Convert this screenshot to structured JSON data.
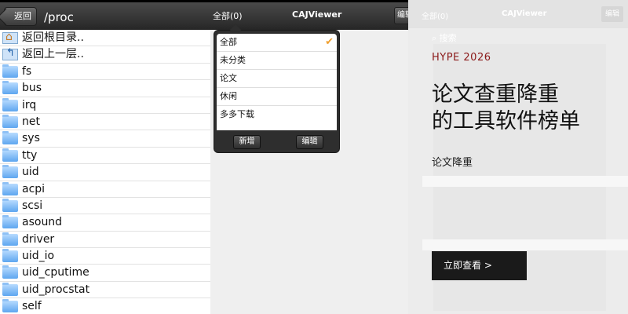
{
  "left": {
    "back_label": "返回",
    "path": "/proc",
    "items": [
      {
        "name": "返回根目录..",
        "icon": "home-icon"
      },
      {
        "name": "返回上一层..",
        "icon": "up-folder-icon"
      },
      {
        "name": "fs",
        "icon": "folder-icon"
      },
      {
        "name": "bus",
        "icon": "folder-icon"
      },
      {
        "name": "irq",
        "icon": "folder-icon"
      },
      {
        "name": "net",
        "icon": "folder-icon"
      },
      {
        "name": "sys",
        "icon": "folder-icon"
      },
      {
        "name": "tty",
        "icon": "folder-icon"
      },
      {
        "name": "uid",
        "icon": "folder-icon"
      },
      {
        "name": "acpi",
        "icon": "folder-icon"
      },
      {
        "name": "scsi",
        "icon": "folder-icon"
      },
      {
        "name": "asound",
        "icon": "folder-icon"
      },
      {
        "name": "driver",
        "icon": "folder-icon"
      },
      {
        "name": "uid_io",
        "icon": "folder-icon"
      },
      {
        "name": "uid_cputime",
        "icon": "folder-icon"
      },
      {
        "name": "uid_procstat",
        "icon": "folder-icon"
      },
      {
        "name": "self",
        "icon": "folder-icon"
      }
    ]
  },
  "middle": {
    "all_label": "全部(0)",
    "title": "CAJViewer",
    "edit_label": "编辑",
    "menu": {
      "items": [
        "全部",
        "未分类",
        "论文",
        "休闲",
        "多多下载"
      ],
      "selected_index": 0,
      "add_label": "新增",
      "edit_label": "编辑"
    }
  },
  "right": {
    "ghost": {
      "all_label": "全部(0)",
      "title": "CAJViewer",
      "edit_label": "编辑",
      "search_label": "搜索"
    },
    "ad": {
      "tag": "HYPE 2026",
      "headline_line1": "论文查重降重",
      "headline_line2": "的工具软件榜单",
      "subtitle": "论文降重",
      "cta": "立即查看 >"
    }
  },
  "colors": {
    "toolbar_dark": "#262626",
    "ad_tag": "#8b1a1a",
    "cta_bg": "#1a1a1a",
    "check": "#f0a030",
    "folder": "#5ea6f0"
  }
}
